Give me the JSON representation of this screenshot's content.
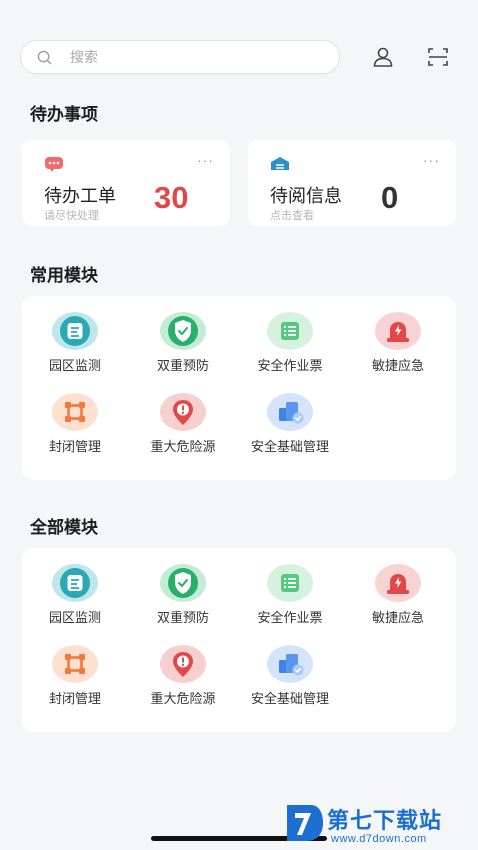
{
  "search": {
    "placeholder": "搜索"
  },
  "sections": {
    "todo": "待办事项",
    "common": "常用模块",
    "all": "全部模块"
  },
  "todo_cards": [
    {
      "label": "待办工单",
      "sub": "请尽快处理",
      "count": "30",
      "count_color": "#e04848",
      "dots": "···"
    },
    {
      "label": "待阅信息",
      "sub": "点击查看",
      "count": "0",
      "count_color": "#333333",
      "dots": "···"
    }
  ],
  "modules": [
    {
      "label": "园区监测",
      "icon": "park-monitor-icon"
    },
    {
      "label": "双重预防",
      "icon": "dual-prevention-shield-icon"
    },
    {
      "label": "安全作业票",
      "icon": "work-ticket-list-icon"
    },
    {
      "label": "敏捷应急",
      "icon": "emergency-alarm-icon"
    },
    {
      "label": "封闭管理",
      "icon": "closed-management-icon"
    },
    {
      "label": "重大危险源",
      "icon": "major-hazard-icon"
    },
    {
      "label": "安全基础管理",
      "icon": "safety-basics-icon"
    }
  ],
  "watermark": {
    "title": "第七下载站",
    "url": "www.d7down.com"
  },
  "colors": {
    "teal": "#2aa9b5",
    "green": "#26b06c",
    "light_green": "#58c782",
    "red": "#e2484a",
    "orange": "#f07a3a",
    "blue": "#3d84e6"
  }
}
